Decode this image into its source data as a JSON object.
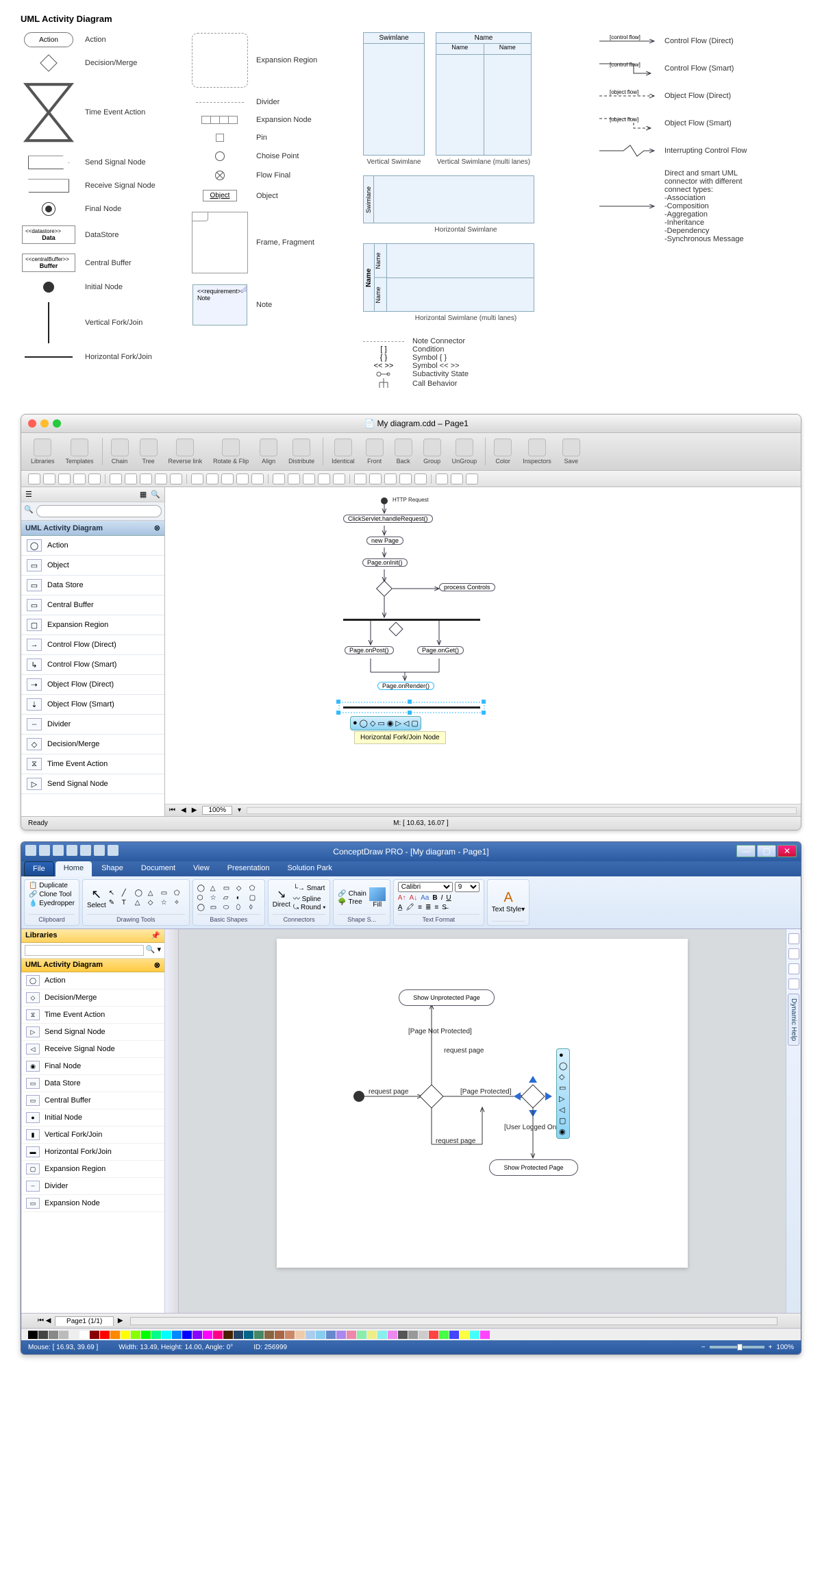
{
  "ref": {
    "title": "UML Activity Diagram",
    "col1": [
      {
        "name": "Action",
        "shape": "action"
      },
      {
        "name": "Decision/Merge",
        "shape": "diamond"
      },
      {
        "name": "Time Event Action",
        "shape": "hourglass"
      },
      {
        "name": "Send Signal Node",
        "shape": "sendsig"
      },
      {
        "name": "Receive Signal Node",
        "shape": "recvsig"
      },
      {
        "name": "Final Node",
        "shape": "final"
      },
      {
        "name": "DataStore",
        "shape": "datastore"
      },
      {
        "name": "Central Buffer",
        "shape": "centralbuffer"
      },
      {
        "name": "Initial Node",
        "shape": "initial"
      },
      {
        "name": "Vertical Fork/Join",
        "shape": "vbar"
      },
      {
        "name": "Horizontal Fork/Join",
        "shape": "hbar"
      }
    ],
    "datastore_top": "<<datastore>>",
    "datastore_bot": "Data",
    "central_top": "<<centralBuffer>>",
    "central_bot": "Buffer",
    "action_text": "Action",
    "col2": [
      {
        "name": "Expansion Region",
        "shape": "dashbox"
      },
      {
        "name": "Divider",
        "shape": "dashline"
      },
      {
        "name": "Expansion Node",
        "shape": "expnode"
      },
      {
        "name": "Pin",
        "shape": "pin"
      },
      {
        "name": "Choise Point",
        "shape": "circ"
      },
      {
        "name": "Flow Final",
        "shape": "flowfin"
      },
      {
        "name": "Object",
        "shape": "object"
      },
      {
        "name": "Frame, Fragment",
        "shape": "frame"
      },
      {
        "name": "Note",
        "shape": "note"
      }
    ],
    "object_text": "Object",
    "note_top": "<<requirement>>",
    "note_bot": "Note",
    "swim_single": "Swimlane",
    "swim_multi_title": "Name",
    "swim_multi_c1": "Name",
    "swim_multi_c2": "Name",
    "cap_vswim": "Vertical Swimlane",
    "cap_vswim_multi": "Vertical Swimlane (multi lanes)",
    "cap_hswim": "Horizontal Swimlane",
    "cap_hswim_multi": "Horizontal Swimlane (multi lanes)",
    "swim_hside": "Swimlane",
    "swim_h_name": "Name",
    "arrows": [
      {
        "l": "[control flow]",
        "r": "Control Flow (Direct)",
        "s": "solid",
        "k": "straight"
      },
      {
        "l": "[control flow]",
        "r": "Control Flow (Smart)",
        "s": "solid",
        "k": "bent"
      },
      {
        "l": "[object flow]",
        "r": "Object Flow (Direct)",
        "s": "dash",
        "k": "straight"
      },
      {
        "l": "[object flow]",
        "r": "Object Flow (Smart)",
        "s": "dash",
        "k": "bent"
      },
      {
        "l": "",
        "r": "Interrupting Control Flow",
        "s": "solid",
        "k": "zig"
      },
      {
        "l": "",
        "r": "Direct and smart UML connector with different connect types:\n-Association\n-Composition\n-Aggregation\n-Inheritance\n-Dependency\n-Synchronous Message",
        "s": "solid",
        "k": "straight"
      }
    ],
    "legend": [
      {
        "sym": "dashed-line",
        "txt": "Note Connector"
      },
      {
        "sym": "[ ]",
        "txt": "Condition"
      },
      {
        "sym": "{ }",
        "txt": "Symbol { }"
      },
      {
        "sym": "<< >>",
        "txt": "Symbol << >>"
      },
      {
        "sym": "sub",
        "txt": "Subactivity State"
      },
      {
        "sym": "fork",
        "txt": "Call Behavior"
      }
    ]
  },
  "mac": {
    "title": "My diagram.cdd – Page1",
    "toolbar": [
      "Libraries",
      "Templates",
      "Chain",
      "Tree",
      "Reverse link",
      "Rotate & Flip",
      "Align",
      "Distribute",
      "Identical",
      "Front",
      "Back",
      "Group",
      "UnGroup",
      "Color",
      "Inspectors",
      "Save"
    ],
    "side_title": "UML Activity Diagram",
    "side_items": [
      "Action",
      "Object",
      "Data Store",
      "Central Buffer",
      "Expansion Region",
      "Control Flow (Direct)",
      "Control Flow (Smart)",
      "Object Flow (Direct)",
      "Object Flow (Smart)",
      "Divider",
      "Decision/Merge",
      "Time Event Action",
      "Send Signal Node"
    ],
    "search_placeholder": "",
    "zoom": "100%",
    "tooltip": "Horizontal Fork/Join Node",
    "status_left": "Ready",
    "status_mid": "M: [ 10.63, 16.07 ]",
    "nodes": {
      "start": "HTTP Request",
      "n1": "ClickServlet.handleRequest()",
      "n2": "new Page",
      "n3": "Page.onInit()",
      "n4": "process Controls",
      "n5": "Page.onPost()",
      "n6": "Page.onGet()",
      "n7": "Page.onRender()"
    }
  },
  "win": {
    "title": "ConceptDraw PRO - [My diagram - Page1]",
    "tabs": [
      "File",
      "Home",
      "Shape",
      "Document",
      "View",
      "Presentation",
      "Solution Park"
    ],
    "clipboard": {
      "title": "Clipboard",
      "items": [
        "Duplicate",
        "Clone Tool",
        "Eyedropper"
      ]
    },
    "drawing": {
      "title": "Drawing Tools",
      "select": "Select"
    },
    "shapes": {
      "title": "Basic Shapes"
    },
    "connectors": {
      "title": "Connectors",
      "direct": "Direct",
      "items": [
        "Smart",
        "Spline",
        "Round"
      ]
    },
    "shapestyle": {
      "title": "Shape S...",
      "chain": "Chain",
      "tree": "Tree",
      "fill": "Fill"
    },
    "textfmt": {
      "title": "Text Format",
      "font": "Calibri",
      "size": "9"
    },
    "textstyle": {
      "title": "Text Style"
    },
    "side_lib": "Libraries",
    "side_title": "UML Activity Diagram",
    "side_items": [
      "Action",
      "Decision/Merge",
      "Time Event Action",
      "Send Signal Node",
      "Receive Signal Node",
      "Final Node",
      "Data Store",
      "Central Buffer",
      "Initial Node",
      "Vertical Fork/Join",
      "Horizontal Fork/Join",
      "Expansion Region",
      "Divider",
      "Expansion Node"
    ],
    "dyn_help": "Dynamic Help",
    "canvas": {
      "n1": "Show Unprotected Page",
      "l1": "[Page Not Protected]",
      "l2": "request page",
      "l3": "request page",
      "l4": "[Page Protected]",
      "l5": "request page",
      "l6": "[User Logged On]",
      "n2": "Show Protected Page"
    },
    "page_tab": "Page1 (1/1)",
    "status": {
      "mouse": "Mouse: [ 16.93, 39.69 ]",
      "size": "Width: 13.49,   Height: 14.00,   Angle: 0°",
      "id": "ID: 256999",
      "zoom": "100%"
    }
  }
}
